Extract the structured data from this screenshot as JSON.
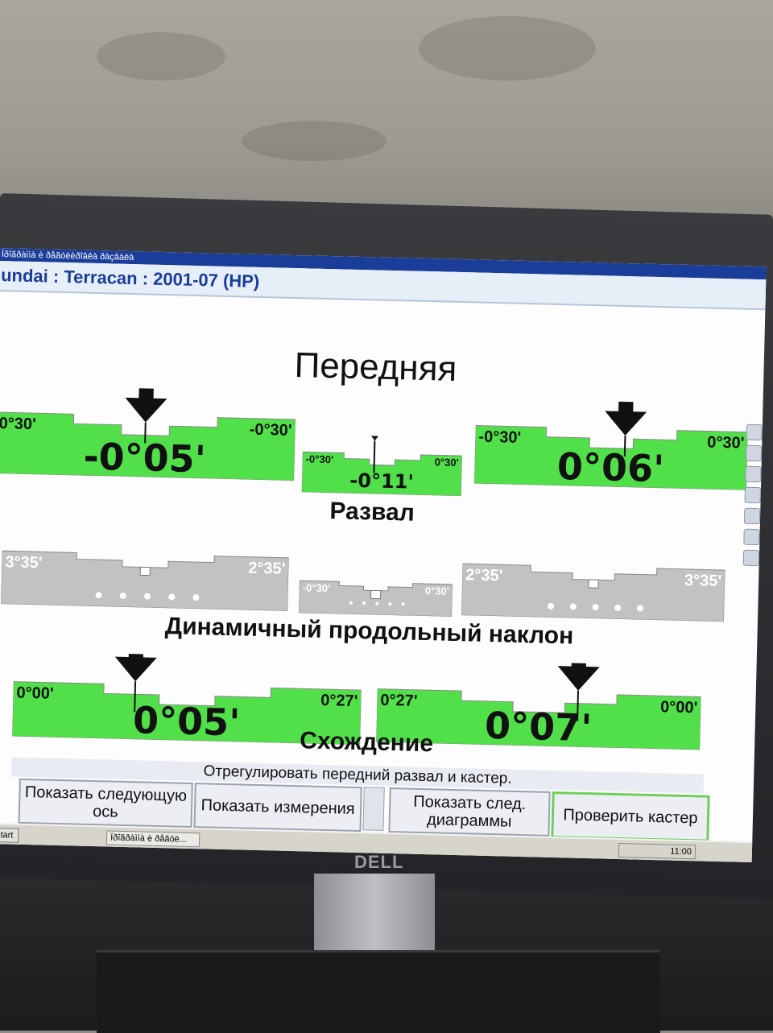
{
  "window": {
    "title": "Ïðîãðàììà è ðåãóëèðîâêà ðàçâàëà",
    "vehicle": "undai : Terracan : 2001-07 (HP)"
  },
  "heading": "Передняя",
  "sections": {
    "camber": "Развал",
    "caster": "Динамичный продольный наклон",
    "toe": "Схождение"
  },
  "camber": {
    "left": {
      "low": "0°30'",
      "high": "-0°30'",
      "value": "-0°05'",
      "status": "in-range"
    },
    "cross": {
      "low": "-0°30'",
      "high": "0°30'",
      "value": "-0°11'",
      "status": "in-range"
    },
    "right": {
      "low": "-0°30'",
      "high": "0°30'",
      "value": "0°06'",
      "status": "in-range"
    }
  },
  "caster": {
    "left": {
      "low": "3°35'",
      "high": "2°35'",
      "status": "not-measured"
    },
    "cross": {
      "low": "-0°30'",
      "high": "0°30'",
      "status": "not-measured"
    },
    "right": {
      "low": "2°35'",
      "high": "3°35'",
      "status": "not-measured"
    }
  },
  "toe": {
    "left": {
      "low": "0°00'",
      "high": "0°27'",
      "value": "0°05'",
      "status": "in-range"
    },
    "right": {
      "low": "0°27'",
      "high": "0°00'",
      "value": "0°07'",
      "status": "in-range"
    }
  },
  "status_text": "Отрегулировать передний развал и кастер.",
  "buttons": {
    "next_axle": "Показать следующую ось",
    "measurements": "Показать измерения",
    "next_charts": "Показать след. диаграммы",
    "check_caster": "Проверить кастер"
  },
  "taskbar": {
    "start": "Start",
    "task": "Ïðîãðàììà è ðåãóë...",
    "clock": "11:00"
  },
  "monitor_brand": "DELL",
  "colors": {
    "in_range": "#52e04a",
    "not_measured": "#c2c2c2",
    "title_bg": "#1b3d9a"
  }
}
